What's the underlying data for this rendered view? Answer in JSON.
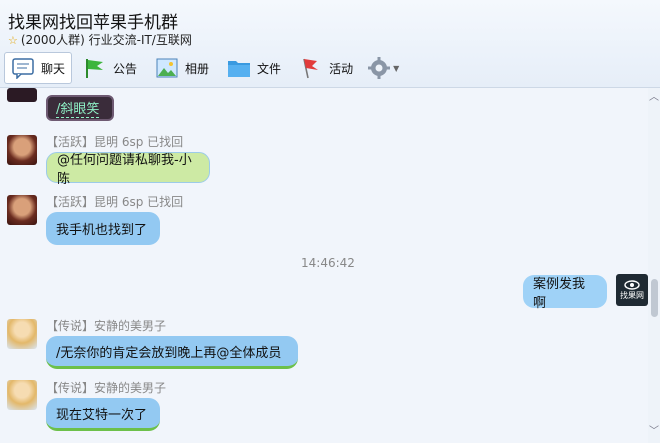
{
  "window": {
    "title": "找果网找回苹果手机群",
    "member_count": "(2000人群)",
    "category": "行业交流-IT/互联网"
  },
  "toolbar": {
    "items": [
      {
        "label": "聊天",
        "icon": "chat-icon"
      },
      {
        "label": "公告",
        "icon": "flag-icon"
      },
      {
        "label": "相册",
        "icon": "photo-icon"
      },
      {
        "label": "文件",
        "icon": "folder-icon"
      },
      {
        "label": "活动",
        "icon": "red-flag-icon"
      }
    ],
    "settings_icon": "gear-icon"
  },
  "messages": [
    {
      "nick": "",
      "text": "/斜眼笑"
    },
    {
      "nick": "【活跃】昆明 6sp 已找回",
      "text": "@任何问题请私聊我-小陈"
    },
    {
      "nick": "【活跃】昆明 6sp 已找回",
      "text": "我手机也找到了"
    },
    {
      "time": "14:46:42"
    },
    {
      "nick": "",
      "text": "案例发我啊",
      "self": true,
      "avatar_text": "找果网"
    },
    {
      "nick": "【传说】安静的美男子",
      "text": "/无奈你的肯定会放到晚上再@全体成员"
    },
    {
      "nick": "【传说】安静的美男子",
      "text": "现在艾特一次了"
    }
  ],
  "colors": {
    "bubble_green": "#cdeaa4",
    "bubble_blue": "#93c9f2",
    "bubble_self": "#9fd2f7",
    "sticker_bg": "#3a2c3a",
    "sticker_text": "#8ef0c6"
  }
}
